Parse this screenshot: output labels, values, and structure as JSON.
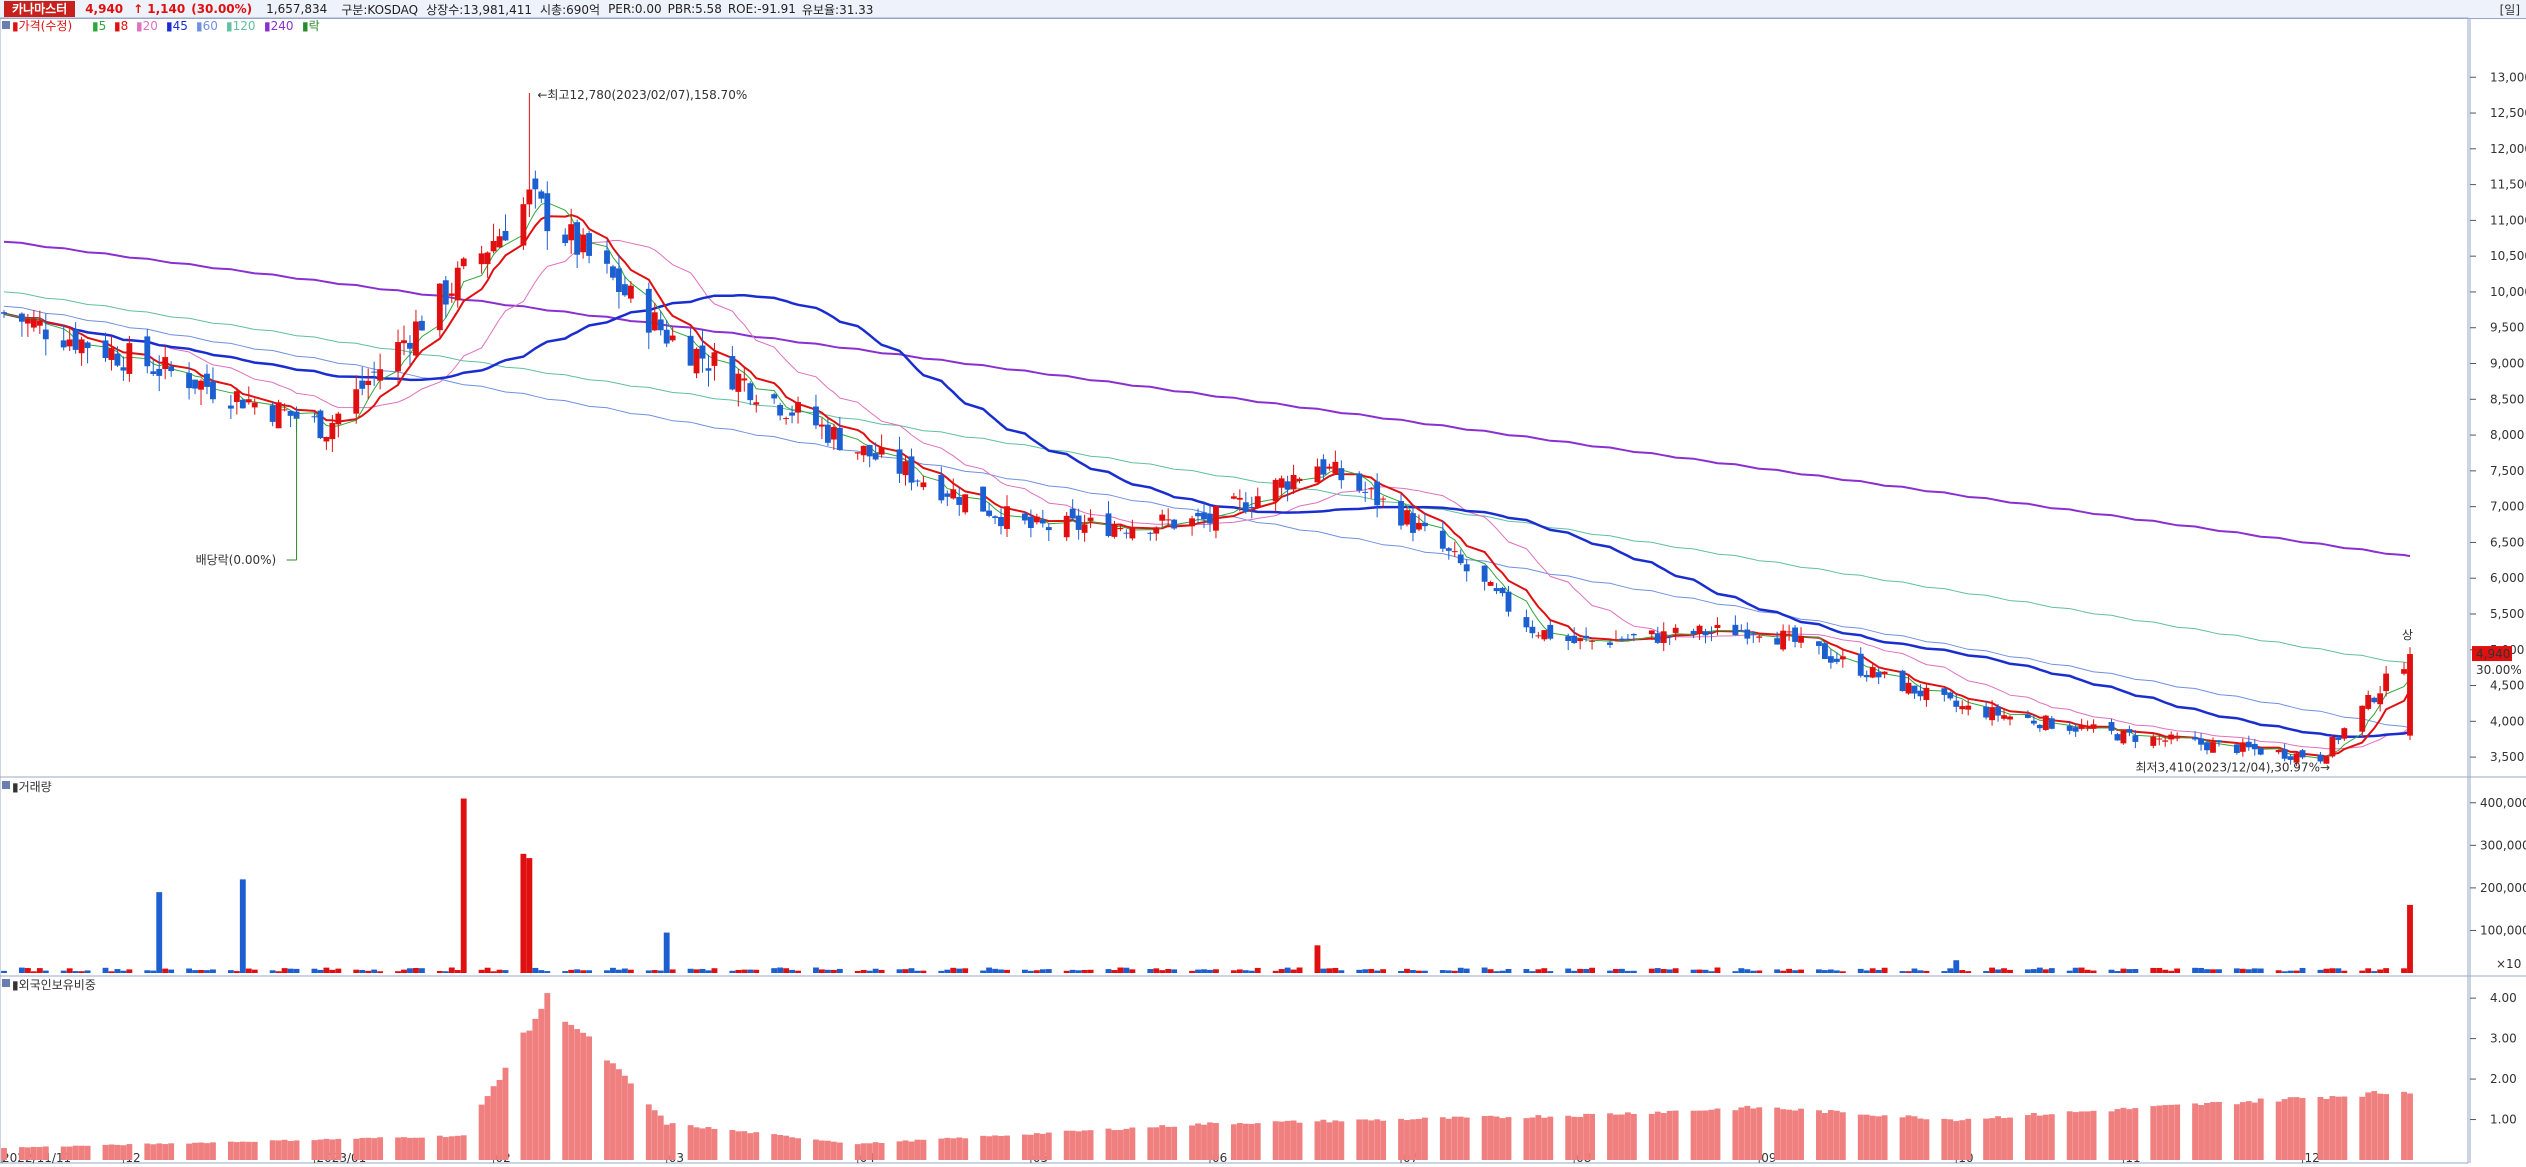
{
  "header": {
    "name": "카나마스터",
    "price": "4,940",
    "change_arrow": "↑",
    "change": "1,140",
    "change_pct": "(30.00%)",
    "volume": "1,657,834",
    "market": "구분:KOSDAQ",
    "listed": "상장수:13,981,411",
    "mktcap": "시총:690억",
    "per": "PER:0.00",
    "pbr": "PBR:5.58",
    "roe": "ROE:-91.91",
    "retention": "유보율:31.33",
    "period": "[일]"
  },
  "chart_data": [
    {
      "type": "candlestick",
      "legend": [
        "가격(수정)",
        "5",
        "8",
        "20",
        "45",
        "60",
        "120",
        "240",
        "락"
      ],
      "colors": {
        "up": "#e01010",
        "down": "#1c5fd0",
        "ma5": "#2ea83a",
        "ma8": "#e01010",
        "ma20": "#e070c0",
        "ma45": "#1a2ed0",
        "ma60": "#7090e0",
        "ma120": "#60c0a0",
        "ma240": "#8a30d0"
      },
      "y_ticks": [
        "3,500",
        "4,000",
        "4,500",
        "5,000",
        "5,500",
        "6,000",
        "6,500",
        "7,000",
        "7,500",
        "8,000",
        "8,500",
        "9,000",
        "9,500",
        "10,000",
        "10,500",
        "11,000",
        "11,500",
        "12,000",
        "12,500",
        "13,000"
      ],
      "ylim": [
        3250,
        13800
      ],
      "x_labels": [
        "2022/11/11",
        "12",
        "2023/01",
        "02",
        "03",
        "04",
        "05",
        "06",
        "07",
        "08",
        "09",
        "10",
        "11",
        "12"
      ],
      "annotations": {
        "high": "최고12,780(2023/02/07),158.70%",
        "low": "최저3,410(2023/12/04),30.97%",
        "dividend": "배당락(0.00%)",
        "last_price": "4,940",
        "last_pct": "30.00%",
        "up_mark": "상"
      },
      "key_points": [
        {
          "date": "2022/11/11",
          "close": 9700
        },
        {
          "date": "2023/01/04",
          "close": 8100
        },
        {
          "date": "2023/02/07",
          "high": 12780,
          "close": 11300
        },
        {
          "date": "2023/03/02",
          "close": 9400
        },
        {
          "date": "2023/04/03",
          "close": 7800
        },
        {
          "date": "2023/05/02",
          "close": 6700
        },
        {
          "date": "2023/06/01",
          "close": 6800
        },
        {
          "date": "2023/06/19",
          "close": 7600
        },
        {
          "date": "2023/07/03",
          "close": 6900
        },
        {
          "date": "2023/07/25",
          "close": 5300
        },
        {
          "date": "2023/08/01",
          "close": 5100
        },
        {
          "date": "2023/09/01",
          "close": 5300
        },
        {
          "date": "2023/10/04",
          "close": 4200
        },
        {
          "date": "2023/11/01",
          "close": 3800
        },
        {
          "date": "2023/12/04",
          "low": 3410,
          "close": 3500
        },
        {
          "date": "2023/12/19",
          "close": 4940
        }
      ],
      "ma240": {
        "start": 10700,
        "end": 6300
      },
      "ma120": {
        "start": 10000,
        "end": 4800
      },
      "ma60": {
        "start": 9800,
        "end": 3900
      }
    },
    {
      "type": "bar",
      "legend": [
        "거래량"
      ],
      "y_ticks": [
        "100,000",
        "200,000",
        "300,000",
        "400,000"
      ],
      "unit_note": "×10",
      "ylim": [
        0,
        430000
      ],
      "spikes": [
        {
          "date": "2022/12/07",
          "value": 190000
        },
        {
          "date": "2022/12/21",
          "value": 220000
        },
        {
          "date": "2023/01/27",
          "value": 410000
        },
        {
          "date": "2023/02/06",
          "value": 280000
        },
        {
          "date": "2023/02/07",
          "value": 270000
        },
        {
          "date": "2023/03/02",
          "value": 95000
        },
        {
          "date": "2023/06/19",
          "value": 65000
        },
        {
          "date": "2023/10/04",
          "value": 30000
        },
        {
          "date": "2023/12/19",
          "value": 160000
        }
      ]
    },
    {
      "type": "bar",
      "legend": [
        "외국인보유비중"
      ],
      "y_ticks": [
        "1.00",
        "2.00",
        "3.00",
        "4.00"
      ],
      "ylim": [
        0,
        4.3
      ],
      "key_points": [
        {
          "date": "2022/11/11",
          "value": 0.3
        },
        {
          "date": "2023/01/27",
          "value": 0.6
        },
        {
          "date": "2023/02/10",
          "value": 4.0
        },
        {
          "date": "2023/02/20",
          "value": 2.5
        },
        {
          "date": "2023/03/02",
          "value": 0.9
        },
        {
          "date": "2023/04/03",
          "value": 0.4
        },
        {
          "date": "2023/06/01",
          "value": 0.9
        },
        {
          "date": "2023/08/01",
          "value": 1.1
        },
        {
          "date": "2023/09/01",
          "value": 1.3
        },
        {
          "date": "2023/10/04",
          "value": 1.0
        },
        {
          "date": "2023/12/19",
          "value": 1.7
        }
      ]
    }
  ]
}
